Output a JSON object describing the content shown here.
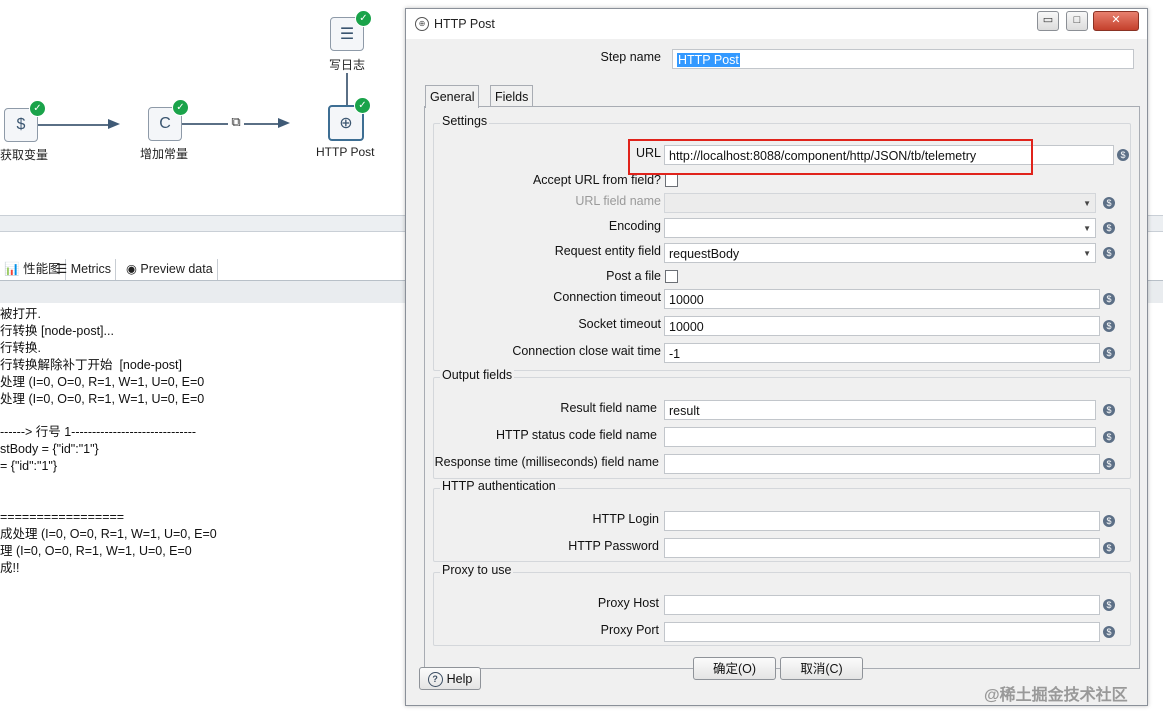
{
  "canvas": {
    "nodes": [
      {
        "label": "获取变量",
        "icon": "get-variables-icon",
        "glyph": "$"
      },
      {
        "label": "增加常量",
        "icon": "add-constants-icon",
        "glyph": "C"
      },
      {
        "label": "HTTP Post",
        "icon": "http-globe-icon",
        "glyph": "⊕"
      },
      {
        "label": "写日志",
        "icon": "write-log-icon",
        "glyph": "☰"
      }
    ],
    "copy_icon": "copy-rows-icon"
  },
  "bottom_tabs": [
    {
      "label": "性能图",
      "icon": "chart-icon"
    },
    {
      "label": "Metrics",
      "icon": "metrics-icon"
    },
    {
      "label": "Preview data",
      "icon": "eye-icon"
    }
  ],
  "log_lines": [
    "被打开.",
    "行转换 [node-post]...",
    "行转换.",
    "行转换解除补丁开始  [node-post]",
    "处理 (I=0, O=0, R=1, W=1, U=0, E=0",
    "处理 (I=0, O=0, R=1, W=1, U=0, E=0",
    "",
    "------> 行号 1------------------------------",
    "stBody = {\"id\":\"1\"}",
    "= {\"id\":\"1\"}",
    "",
    "",
    "=================",
    "成处理 (I=0, O=0, R=1, W=1, U=0, E=0",
    "理 (I=0, O=0, R=1, W=1, U=0, E=0",
    "成!!"
  ],
  "dialog": {
    "title": "HTTP Post",
    "window_buttons": {
      "minimize": "▭",
      "maximize": "□",
      "close": "✕"
    },
    "step_name_label": "Step name",
    "step_name_value": "HTTP Post",
    "tabs": [
      "General",
      "Fields"
    ],
    "settings": {
      "title": "Settings",
      "url_label": "URL",
      "url_value": "http://localhost:8088/component/http/JSON/tb/telemetry",
      "accept_url_label": "Accept URL from field?",
      "url_field_name_label": "URL field name",
      "encoding_label": "Encoding",
      "encoding_value": "",
      "request_entity_label": "Request entity field",
      "request_entity_value": "requestBody",
      "post_file_label": "Post a file",
      "connection_timeout_label": "Connection timeout",
      "connection_timeout_value": "10000",
      "socket_timeout_label": "Socket timeout",
      "socket_timeout_value": "10000",
      "close_wait_label": "Connection close wait time",
      "close_wait_value": "-1"
    },
    "output_fields": {
      "title": "Output fields",
      "result_label": "Result field name",
      "result_value": "result",
      "status_label": "HTTP status code field name",
      "status_value": "",
      "response_time_label": "Response time (milliseconds) field name",
      "response_time_value": ""
    },
    "auth": {
      "title": "HTTP authentication",
      "login_label": "HTTP Login",
      "password_label": "HTTP Password"
    },
    "proxy": {
      "title": "Proxy to use",
      "host_label": "Proxy Host",
      "port_label": "Proxy Port"
    },
    "ok_label": "确定(O)",
    "cancel_label": "取消(C)",
    "help_label": "Help",
    "variable_icon_glyph": "$"
  },
  "watermark": "@稀土掘金技术社区",
  "watermark_url": "https://blog.csdn.net/...",
  "colors": {
    "highlight_box": "#e0231b",
    "check_green": "#1aa34a",
    "selection_blue": "#3399ff"
  }
}
